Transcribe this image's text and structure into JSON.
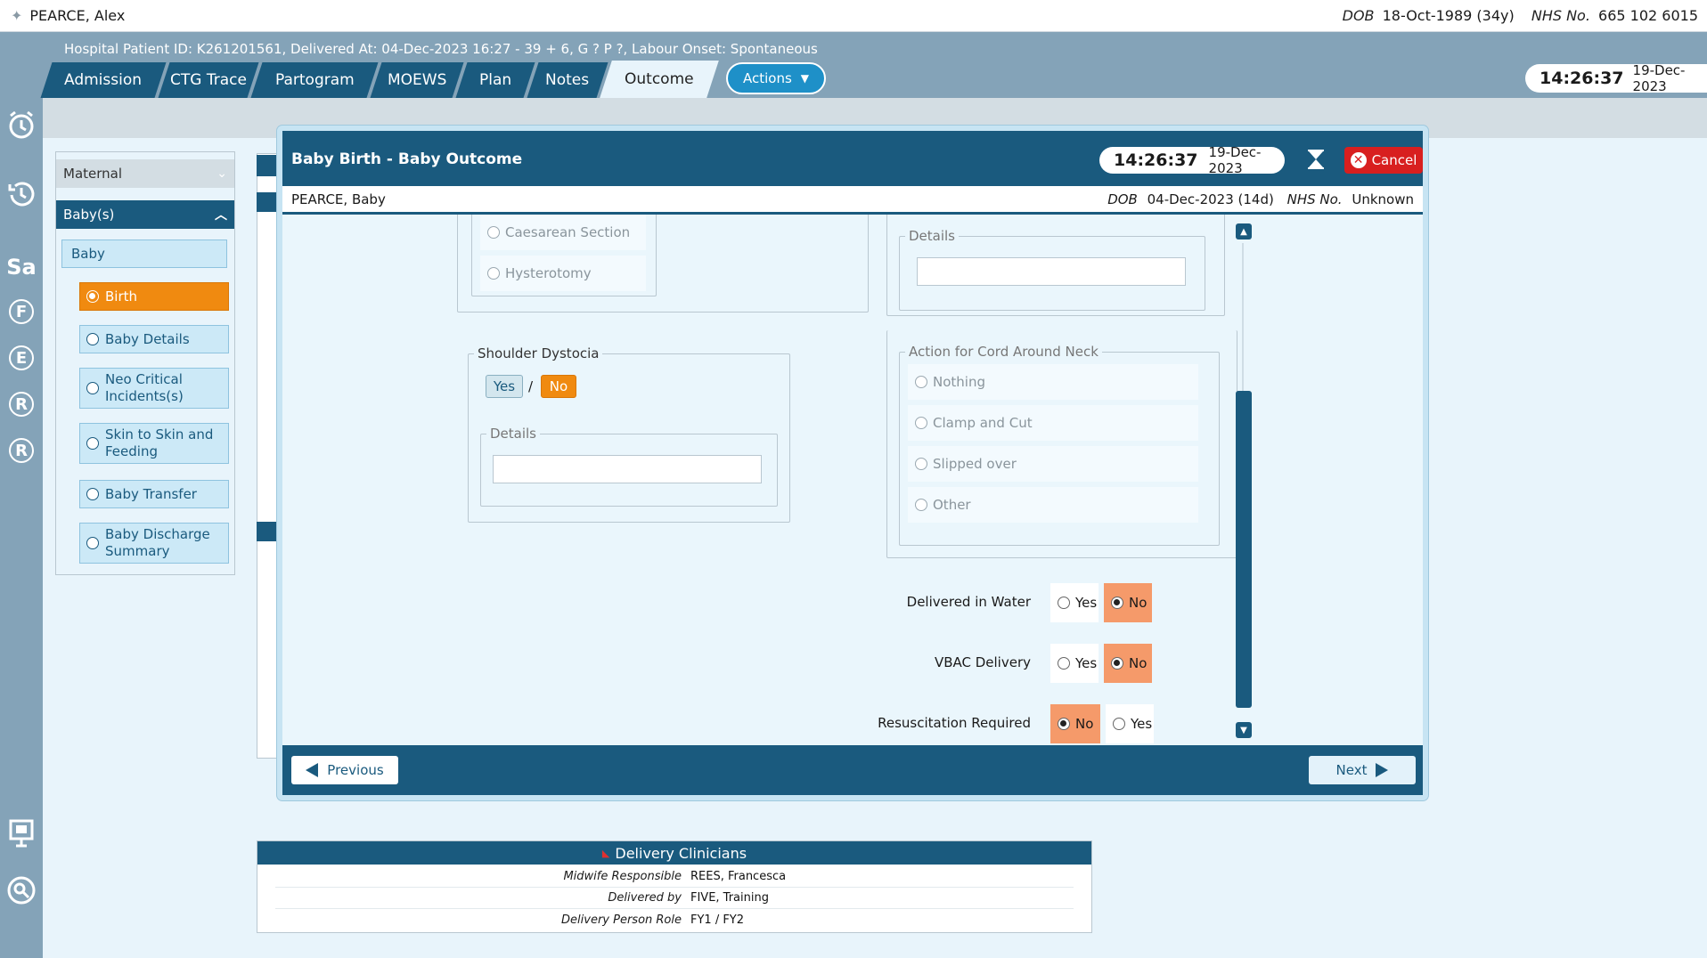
{
  "patient_bar": {
    "name": "PEARCE, Alex",
    "dob_label": "DOB",
    "dob_value": "18-Oct-1989 (34y)",
    "nhs_label": "NHS No.",
    "nhs_value": "665 102 6015"
  },
  "header": {
    "info": "Hospital Patient ID: K261201561, Delivered At: 04-Dec-2023 16:27 - 39 + 6, G ? P ?,   Labour Onset: Spontaneous",
    "tabs": [
      {
        "label": "Admission"
      },
      {
        "label": "CTG Trace"
      },
      {
        "label": "Partogram"
      },
      {
        "label": "MOEWS"
      },
      {
        "label": "Plan"
      },
      {
        "label": "Notes"
      },
      {
        "label": "Outcome"
      }
    ],
    "actions_label": "Actions",
    "clock_time": "14:26:37",
    "clock_date": "19-Dec-2023"
  },
  "rail": {
    "labels": [
      "Sa",
      "F",
      "E",
      "R",
      "R"
    ]
  },
  "nav": {
    "maternal": "Maternal",
    "babies": "Baby(s)",
    "baby": "Baby",
    "steps": [
      {
        "label": "Birth"
      },
      {
        "label": "Baby Details"
      },
      {
        "label": "Neo Critical Incidents(s)"
      },
      {
        "label": "Skin to Skin and Feeding"
      },
      {
        "label": "Baby Transfer"
      },
      {
        "label": "Baby Discharge Summary"
      }
    ]
  },
  "modal": {
    "title": "Baby Birth - Baby Outcome",
    "clock_time": "14:26:37",
    "clock_date": "19-Dec-2023",
    "cancel_label": "Cancel",
    "baby_name": "PEARCE, Baby",
    "dob_label": "DOB",
    "dob_value": "04-Dec-2023 (14d)",
    "nhs_label": "NHS No.",
    "nhs_value": "Unknown",
    "prev_label": "Previous",
    "next_label": "Next",
    "delivery_options": [
      "Caesarean Section",
      "Hysterotomy"
    ],
    "details_label": "Details",
    "shoulder_dystocia": {
      "legend": "Shoulder Dystocia",
      "yes": "Yes",
      "sep": "/",
      "no": "No",
      "details_label": "Details"
    },
    "cord_action": {
      "legend": "Action for Cord Around Neck",
      "options": [
        "Nothing",
        "Clamp and Cut",
        "Slipped over",
        "Other"
      ]
    },
    "questions": [
      {
        "label": "Delivered in Water",
        "first": "Yes",
        "second": "No",
        "selected": "second"
      },
      {
        "label": "VBAC Delivery",
        "first": "Yes",
        "second": "No",
        "selected": "second"
      },
      {
        "label": "Resuscitation Required",
        "first": "No",
        "second": "Yes",
        "selected": "first"
      }
    ]
  },
  "delivery_clinicians": {
    "title": "Delivery Clinicians",
    "rows": [
      {
        "label": "Midwife Responsible",
        "value": "REES, Francesca"
      },
      {
        "label": "Delivered by",
        "value": "FIVE, Training"
      },
      {
        "label": "Delivery Person Role",
        "value": "FY1 / FY2"
      }
    ]
  },
  "colors": {
    "primary": "#1a5a7e",
    "accent": "#f08a10",
    "selected": "#f59a6a",
    "cancel": "#d81f1f",
    "header": "#84a3b8"
  }
}
